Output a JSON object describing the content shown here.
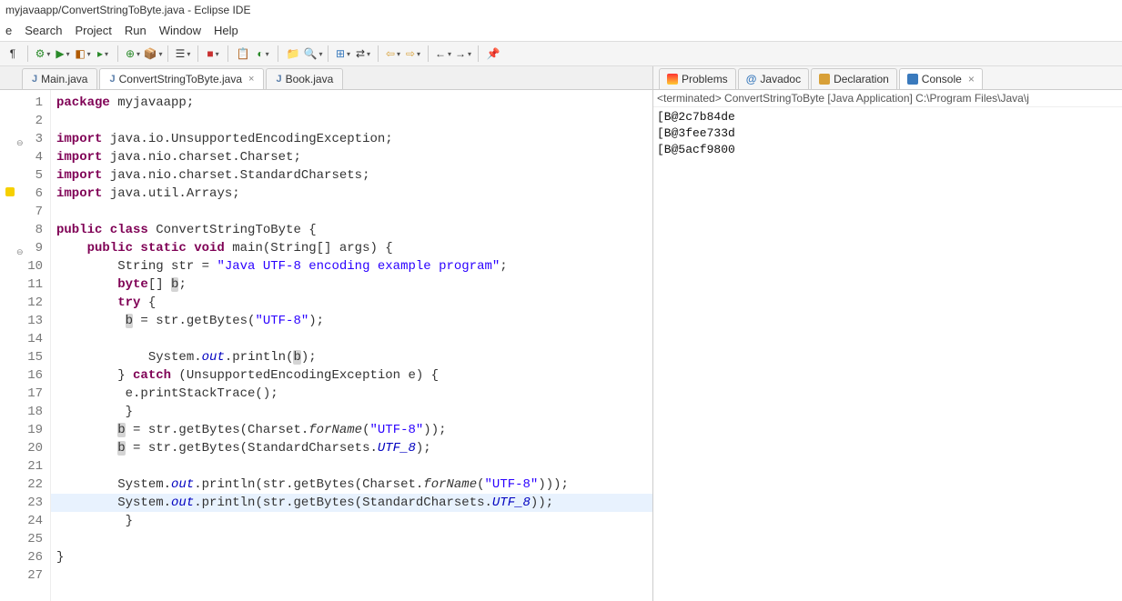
{
  "window": {
    "title": "myjavaapp/ConvertStringToByte.java - Eclipse IDE"
  },
  "menu": {
    "items": [
      "e",
      "Search",
      "Project",
      "Run",
      "Window",
      "Help"
    ]
  },
  "editor_tabs": [
    {
      "label": "Main.java",
      "active": false,
      "closeable": false
    },
    {
      "label": "ConvertStringToByte.java",
      "active": true,
      "closeable": true
    },
    {
      "label": "Book.java",
      "active": false,
      "closeable": false
    }
  ],
  "right_tabs": [
    {
      "label": "Problems",
      "active": false
    },
    {
      "label": "Javadoc",
      "active": false
    },
    {
      "label": "Declaration",
      "active": false
    },
    {
      "label": "Console",
      "active": true,
      "closeable": true
    }
  ],
  "console": {
    "status": "<terminated> ConvertStringToByte [Java Application] C:\\Program Files\\Java\\j",
    "lines": [
      "[B@2c7b84de",
      "[B@3fee733d",
      "[B@5acf9800"
    ]
  },
  "code": {
    "highlight_line": 23,
    "lines": [
      {
        "n": 1,
        "tokens": [
          [
            "kw",
            "package"
          ],
          [
            "",
            " myjavaapp;"
          ]
        ]
      },
      {
        "n": 2,
        "tokens": [
          [
            "",
            ""
          ]
        ]
      },
      {
        "n": 3,
        "fold": "⊖",
        "tokens": [
          [
            "kw",
            "import"
          ],
          [
            "",
            " java.io.UnsupportedEncodingException;"
          ]
        ]
      },
      {
        "n": 4,
        "tokens": [
          [
            "kw",
            "import"
          ],
          [
            "",
            " java.nio.charset.Charset;"
          ]
        ]
      },
      {
        "n": 5,
        "tokens": [
          [
            "kw",
            "import"
          ],
          [
            "",
            " java.nio.charset.StandardCharsets;"
          ]
        ]
      },
      {
        "n": 6,
        "marker": "warn",
        "tokens": [
          [
            "kw",
            "import"
          ],
          [
            "",
            " java.util.Arrays;"
          ]
        ]
      },
      {
        "n": 7,
        "tokens": [
          [
            "",
            ""
          ]
        ]
      },
      {
        "n": 8,
        "tokens": [
          [
            "kw",
            "public class"
          ],
          [
            "",
            " ConvertStringToByte {"
          ]
        ]
      },
      {
        "n": 9,
        "fold": "⊖",
        "tokens": [
          [
            "",
            "    "
          ],
          [
            "kw",
            "public static void"
          ],
          [
            "",
            " main(String[] args) {"
          ]
        ]
      },
      {
        "n": 10,
        "tokens": [
          [
            "",
            "        String str = "
          ],
          [
            "str",
            "\"Java UTF-8 encoding example program\""
          ],
          [
            "",
            ";"
          ]
        ]
      },
      {
        "n": 11,
        "tokens": [
          [
            "",
            "        "
          ],
          [
            "kw",
            "byte"
          ],
          [
            "",
            "[] "
          ],
          [
            "varhl",
            "b"
          ],
          [
            "",
            ";"
          ]
        ]
      },
      {
        "n": 12,
        "tokens": [
          [
            "",
            "        "
          ],
          [
            "kw",
            "try"
          ],
          [
            "",
            " {"
          ]
        ]
      },
      {
        "n": 13,
        "tokens": [
          [
            "",
            "         "
          ],
          [
            "varhl",
            "b"
          ],
          [
            "",
            " = str.getBytes("
          ],
          [
            "str",
            "\"UTF-8\""
          ],
          [
            "",
            ");"
          ]
        ]
      },
      {
        "n": 14,
        "tokens": [
          [
            "",
            ""
          ]
        ]
      },
      {
        "n": 15,
        "tokens": [
          [
            "",
            "            System."
          ],
          [
            "it",
            "out"
          ],
          [
            "",
            ".println("
          ],
          [
            "varhl",
            "b"
          ],
          [
            "",
            ");"
          ]
        ]
      },
      {
        "n": 16,
        "tokens": [
          [
            "",
            "        } "
          ],
          [
            "kw",
            "catch"
          ],
          [
            "",
            " (UnsupportedEncodingException e) {"
          ]
        ]
      },
      {
        "n": 17,
        "tokens": [
          [
            "",
            "         e.printStackTrace();"
          ]
        ]
      },
      {
        "n": 18,
        "tokens": [
          [
            "",
            "         }"
          ]
        ]
      },
      {
        "n": 19,
        "tokens": [
          [
            "",
            "        "
          ],
          [
            "varhl",
            "b"
          ],
          [
            "",
            " = str.getBytes(Charset."
          ],
          [
            "it2",
            "forName"
          ],
          [
            "",
            "("
          ],
          [
            "str",
            "\"UTF-8\""
          ],
          [
            "",
            "));"
          ]
        ]
      },
      {
        "n": 20,
        "tokens": [
          [
            "",
            "        "
          ],
          [
            "varhl",
            "b"
          ],
          [
            "",
            " = str.getBytes(StandardCharsets."
          ],
          [
            "it",
            "UTF_8"
          ],
          [
            "",
            ");"
          ]
        ]
      },
      {
        "n": 21,
        "tokens": [
          [
            "",
            ""
          ]
        ]
      },
      {
        "n": 22,
        "tokens": [
          [
            "",
            "        System."
          ],
          [
            "it",
            "out"
          ],
          [
            "",
            ".println(str.getBytes(Charset."
          ],
          [
            "it2",
            "forName"
          ],
          [
            "",
            "("
          ],
          [
            "str",
            "\"UTF-8\""
          ],
          [
            "",
            ")));"
          ]
        ]
      },
      {
        "n": 23,
        "tokens": [
          [
            "",
            "        System."
          ],
          [
            "it",
            "out"
          ],
          [
            "",
            ".println(str.getBytes(StandardCharsets."
          ],
          [
            "it",
            "UTF_8"
          ],
          [
            "",
            "));"
          ]
        ]
      },
      {
        "n": 24,
        "tokens": [
          [
            "",
            "         }"
          ]
        ]
      },
      {
        "n": 25,
        "tokens": [
          [
            "",
            ""
          ]
        ]
      },
      {
        "n": 26,
        "tokens": [
          [
            "",
            "}"
          ]
        ]
      },
      {
        "n": 27,
        "tokens": [
          [
            "",
            ""
          ]
        ]
      }
    ]
  }
}
